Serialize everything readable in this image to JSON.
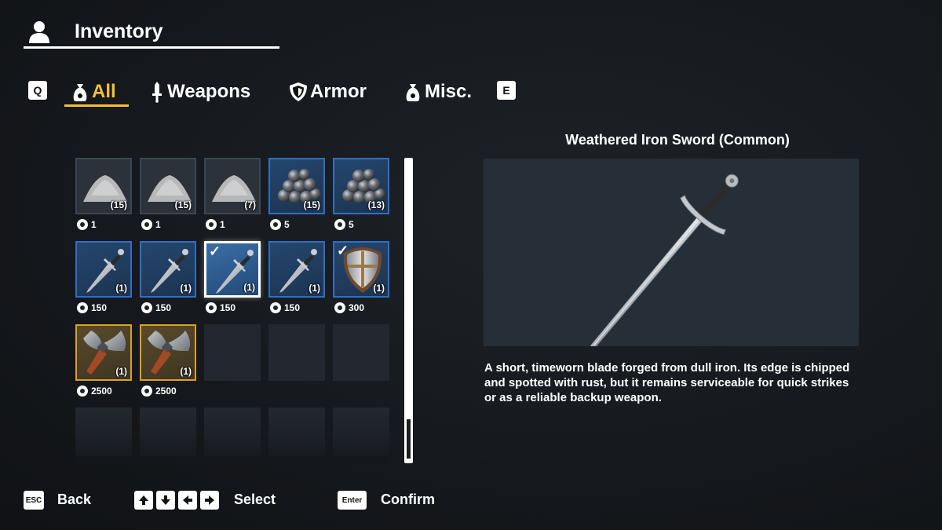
{
  "header": {
    "title": "Inventory",
    "icon": "user-icon"
  },
  "tabs": {
    "prev_key": "Q",
    "next_key": "E",
    "items": [
      {
        "label": "All",
        "icon": "bag-icon",
        "active": true
      },
      {
        "label": "Weapons",
        "icon": "sword-icon",
        "active": false
      },
      {
        "label": "Armor",
        "icon": "shield-icon",
        "active": false
      },
      {
        "label": "Misc.",
        "icon": "bag-icon",
        "active": false
      }
    ],
    "active_color": "#f2c230"
  },
  "inventory": {
    "slots": [
      {
        "item": "powder",
        "quantity": "(15)",
        "price": "1",
        "rarity": "common",
        "equipped": false
      },
      {
        "item": "powder",
        "quantity": "(15)",
        "price": "1",
        "rarity": "common",
        "equipped": false
      },
      {
        "item": "powder",
        "quantity": "(7)",
        "price": "1",
        "rarity": "common",
        "equipped": false
      },
      {
        "item": "iron-balls",
        "quantity": "(15)",
        "price": "5",
        "rarity": "rare",
        "equipped": false
      },
      {
        "item": "iron-balls",
        "quantity": "(13)",
        "price": "5",
        "rarity": "rare",
        "equipped": false
      },
      {
        "item": "sword",
        "quantity": "(1)",
        "price": "150",
        "rarity": "rare",
        "equipped": false
      },
      {
        "item": "sword",
        "quantity": "(1)",
        "price": "150",
        "rarity": "rare",
        "equipped": false
      },
      {
        "item": "sword",
        "quantity": "(1)",
        "price": "150",
        "rarity": "rare",
        "equipped": true,
        "selected": true
      },
      {
        "item": "sword",
        "quantity": "(1)",
        "price": "150",
        "rarity": "rare",
        "equipped": false
      },
      {
        "item": "shield",
        "quantity": "(1)",
        "price": "300",
        "rarity": "rare",
        "equipped": true
      },
      {
        "item": "axe",
        "quantity": "(1)",
        "price": "2500",
        "rarity": "legendary",
        "equipped": false
      },
      {
        "item": "axe",
        "quantity": "(1)",
        "price": "2500",
        "rarity": "legendary",
        "equipped": false
      }
    ],
    "equipped_mark": "✓",
    "colors": {
      "rare": "#2f6fc4",
      "legendary": "#d9a21f",
      "common": "#3c4654"
    }
  },
  "detail": {
    "title": "Weathered Iron Sword (Common)",
    "description": "A short, timeworn blade forged from dull iron. Its edge is chipped and spotted with rust, but it remains serviceable for quick strikes or as a reliable backup weapon."
  },
  "footer": {
    "back_key": "ESC",
    "back_label": "Back",
    "select_label": "Select",
    "confirm_key": "Enter",
    "confirm_label": "Confirm"
  }
}
